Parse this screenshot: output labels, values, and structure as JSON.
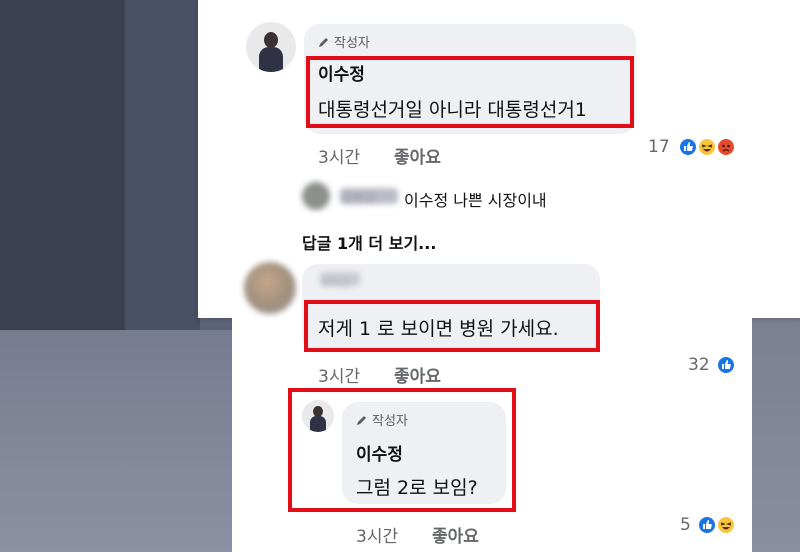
{
  "comment1": {
    "badge": "작성자",
    "name": "이수정",
    "text": "대통령선거일 아니라 대통령선거1",
    "time": "3시간",
    "like_label": "좋아요",
    "reaction_count": "17"
  },
  "reply_preview": {
    "author": "김현교",
    "text": "이수정 나쁜 시장이내"
  },
  "more_replies": "답글 1개 더 보기...",
  "comment2": {
    "name": "이덕교",
    "text": "저게 1 로 보이면 병원 가세요.",
    "time": "3시간",
    "like_label": "좋아요",
    "reaction_count": "32"
  },
  "comment3": {
    "badge": "작성자",
    "name": "이수정",
    "text": "그럼 2로 보임?",
    "time": "3시간",
    "like_label": "좋아요",
    "reaction_count": "5"
  },
  "colors": {
    "highlight_box": "#e30d18",
    "like_blue": "#1b74e4"
  }
}
